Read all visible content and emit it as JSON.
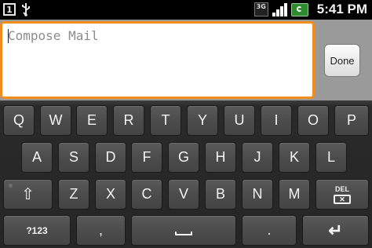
{
  "status_bar": {
    "notification_count": "1",
    "usb_icon": "usb-icon",
    "network_label": "3G",
    "time": "5:41 PM"
  },
  "compose": {
    "placeholder": "Compose Mail",
    "value": "",
    "done_label": "Done",
    "accent": "#f08d1d"
  },
  "keyboard": {
    "row1": [
      "Q",
      "W",
      "E",
      "R",
      "T",
      "Y",
      "U",
      "I",
      "O",
      "P"
    ],
    "row2": [
      "A",
      "S",
      "D",
      "F",
      "G",
      "H",
      "J",
      "K",
      "L"
    ],
    "row3": [
      "Z",
      "X",
      "C",
      "V",
      "B",
      "N",
      "M"
    ],
    "shift_label": "⇧",
    "del_label": "DEL",
    "symbols_label": "?123",
    "comma_label": ",",
    "period_label": ".",
    "enter_label": "↵"
  }
}
